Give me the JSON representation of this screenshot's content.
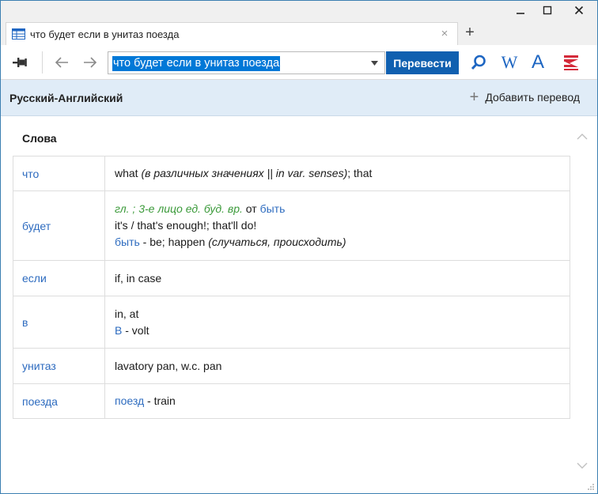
{
  "window": {
    "minimize_glyph": "–",
    "restore_glyph": "□",
    "close_glyph": "✕"
  },
  "tab": {
    "title": "что будет если в унитаз поезда",
    "close_glyph": "×",
    "add_glyph": "+"
  },
  "toolbar": {
    "search_value": "что будет если в унитаз поезда",
    "translate_label": "Перевести",
    "wiki_label": "W",
    "dictionary_label": "A",
    "icons": [
      "pin-icon",
      "back-arrow-icon",
      "forward-arrow-icon",
      "dropdown-arrow-icon",
      "search-icon",
      "wikipedia-icon",
      "font-icon",
      "abbyy-logo-icon"
    ]
  },
  "langbar": {
    "title": "Русский-Английский",
    "add_label": "Добавить перевод",
    "add_glyph": "+"
  },
  "section": {
    "title": "Слова"
  },
  "rows": [
    {
      "word": "что",
      "lines": [
        {
          "parts": [
            {
              "t": "what ",
              "s": "plain"
            },
            {
              "t": "(в различных значениях || in var. senses)",
              "s": "italic"
            },
            {
              "t": "; that",
              "s": "plain"
            }
          ]
        }
      ]
    },
    {
      "word": "будет",
      "lines": [
        {
          "parts": [
            {
              "t": "гл. ; 3-е лицо ед. буд. вр.",
              "s": "gram"
            },
            {
              "t": " от ",
              "s": "plain"
            },
            {
              "t": "быть",
              "s": "link"
            }
          ]
        },
        {
          "parts": [
            {
              "t": "it's / that's enough!; that'll do!",
              "s": "plain"
            }
          ]
        },
        {
          "parts": [
            {
              "t": "быть",
              "s": "link"
            },
            {
              "t": " - be; happen ",
              "s": "plain"
            },
            {
              "t": "(случаться, происходить)",
              "s": "italic"
            }
          ]
        }
      ]
    },
    {
      "word": "если",
      "lines": [
        {
          "parts": [
            {
              "t": "if, in case",
              "s": "plain"
            }
          ]
        }
      ]
    },
    {
      "word": "в",
      "lines": [
        {
          "parts": [
            {
              "t": "in, at",
              "s": "plain"
            }
          ]
        },
        {
          "parts": [
            {
              "t": "В",
              "s": "link"
            },
            {
              "t": " - volt",
              "s": "plain"
            }
          ]
        }
      ]
    },
    {
      "word": "унитаз",
      "lines": [
        {
          "parts": [
            {
              "t": "lavatory pan, w.c. pan",
              "s": "plain"
            }
          ]
        }
      ]
    },
    {
      "word": "поезда",
      "lines": [
        {
          "parts": [
            {
              "t": "поезд",
              "s": "link"
            },
            {
              "t": " - train",
              "s": "plain"
            }
          ]
        }
      ]
    }
  ],
  "colors": {
    "accent": "#1060b0",
    "link": "#2d6bbf",
    "grammar": "#3b9a3a",
    "header_bg": "#e0ecf7",
    "selection": "#0078d7"
  }
}
